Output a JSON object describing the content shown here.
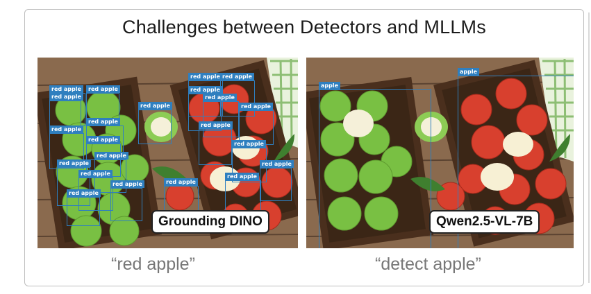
{
  "title": "Challenges between Detectors and MLLMs",
  "panels": [
    {
      "model": "Grounding DINO",
      "caption": "“red apple”",
      "boxes": [
        {
          "label": "red apple"
        },
        {
          "label": "red apple"
        },
        {
          "label": "red apple"
        },
        {
          "label": "red apple"
        },
        {
          "label": "red apple"
        },
        {
          "label": "red apple"
        },
        {
          "label": "red apple"
        },
        {
          "label": "red apple"
        },
        {
          "label": "red apple"
        },
        {
          "label": "red apple"
        },
        {
          "label": "red apple"
        },
        {
          "label": "red apple"
        },
        {
          "label": "red apple"
        },
        {
          "label": "red apple"
        },
        {
          "label": "red apple"
        },
        {
          "label": "red apple"
        },
        {
          "label": "red apple"
        },
        {
          "label": "red apple"
        },
        {
          "label": "red apple"
        },
        {
          "label": "red apple"
        },
        {
          "label": "red apple"
        },
        {
          "label": "red apple"
        }
      ]
    },
    {
      "model": "Qwen2.5-VL-7B",
      "caption": "“detect apple”",
      "boxes": [
        {
          "label": "apple"
        },
        {
          "label": "apple"
        }
      ]
    }
  ]
}
